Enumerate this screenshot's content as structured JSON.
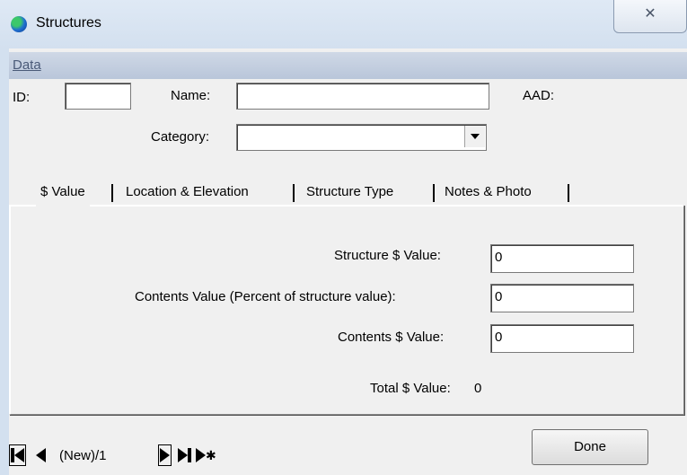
{
  "window": {
    "title": "Structures",
    "close_glyph": "✕",
    "icon": "app-globe-icon"
  },
  "menubar": {
    "items": [
      {
        "label": "Data",
        "accel": "D"
      }
    ]
  },
  "header": {
    "id_label": "ID:",
    "id_value": "",
    "name_label": "Name:",
    "name_value": "",
    "aad_label": "AAD:",
    "aad_value": "",
    "category_label": "Category:",
    "category_value": ""
  },
  "tabs": [
    {
      "label": "$ Value",
      "active": true
    },
    {
      "label": "Location & Elevation",
      "active": false
    },
    {
      "label": "Structure Type",
      "active": false
    },
    {
      "label": "Notes & Photo",
      "active": false
    }
  ],
  "value_tab": {
    "structure_value_label": "Structure $ Value:",
    "structure_value": "0",
    "contents_pct_label": "Contents Value (Percent of structure value):",
    "contents_pct": "0",
    "contents_value_label": "Contents $ Value:",
    "contents_value": "0",
    "total_label": "Total $ Value:",
    "total_value": "0"
  },
  "navigator": {
    "position_text": "(New)/1"
  },
  "footer": {
    "done_label": "Done"
  }
}
